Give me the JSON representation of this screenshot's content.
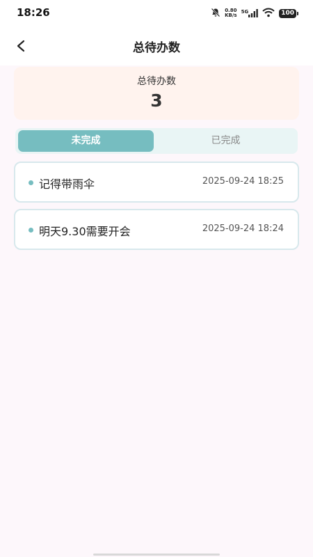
{
  "status_bar": {
    "time": "18:26",
    "net_speed_value": "0.80",
    "net_speed_unit": "KB/s",
    "network_type": "5G",
    "battery": "100"
  },
  "header": {
    "title": "总待办数"
  },
  "summary": {
    "label": "总待办数",
    "count": "3"
  },
  "tabs": [
    {
      "label": "未完成",
      "active": true
    },
    {
      "label": "已完成",
      "active": false
    }
  ],
  "todos": [
    {
      "text": "记得带雨伞",
      "time": "2025-09-24 18:25"
    },
    {
      "text": "明天9.30需要开会",
      "time": "2025-09-24 18:24"
    }
  ],
  "colors": {
    "accent": "#76bdc0",
    "summary_bg": "#fff3ee",
    "page_bg": "#fdf7fb",
    "card_border": "#d7e8ec"
  }
}
